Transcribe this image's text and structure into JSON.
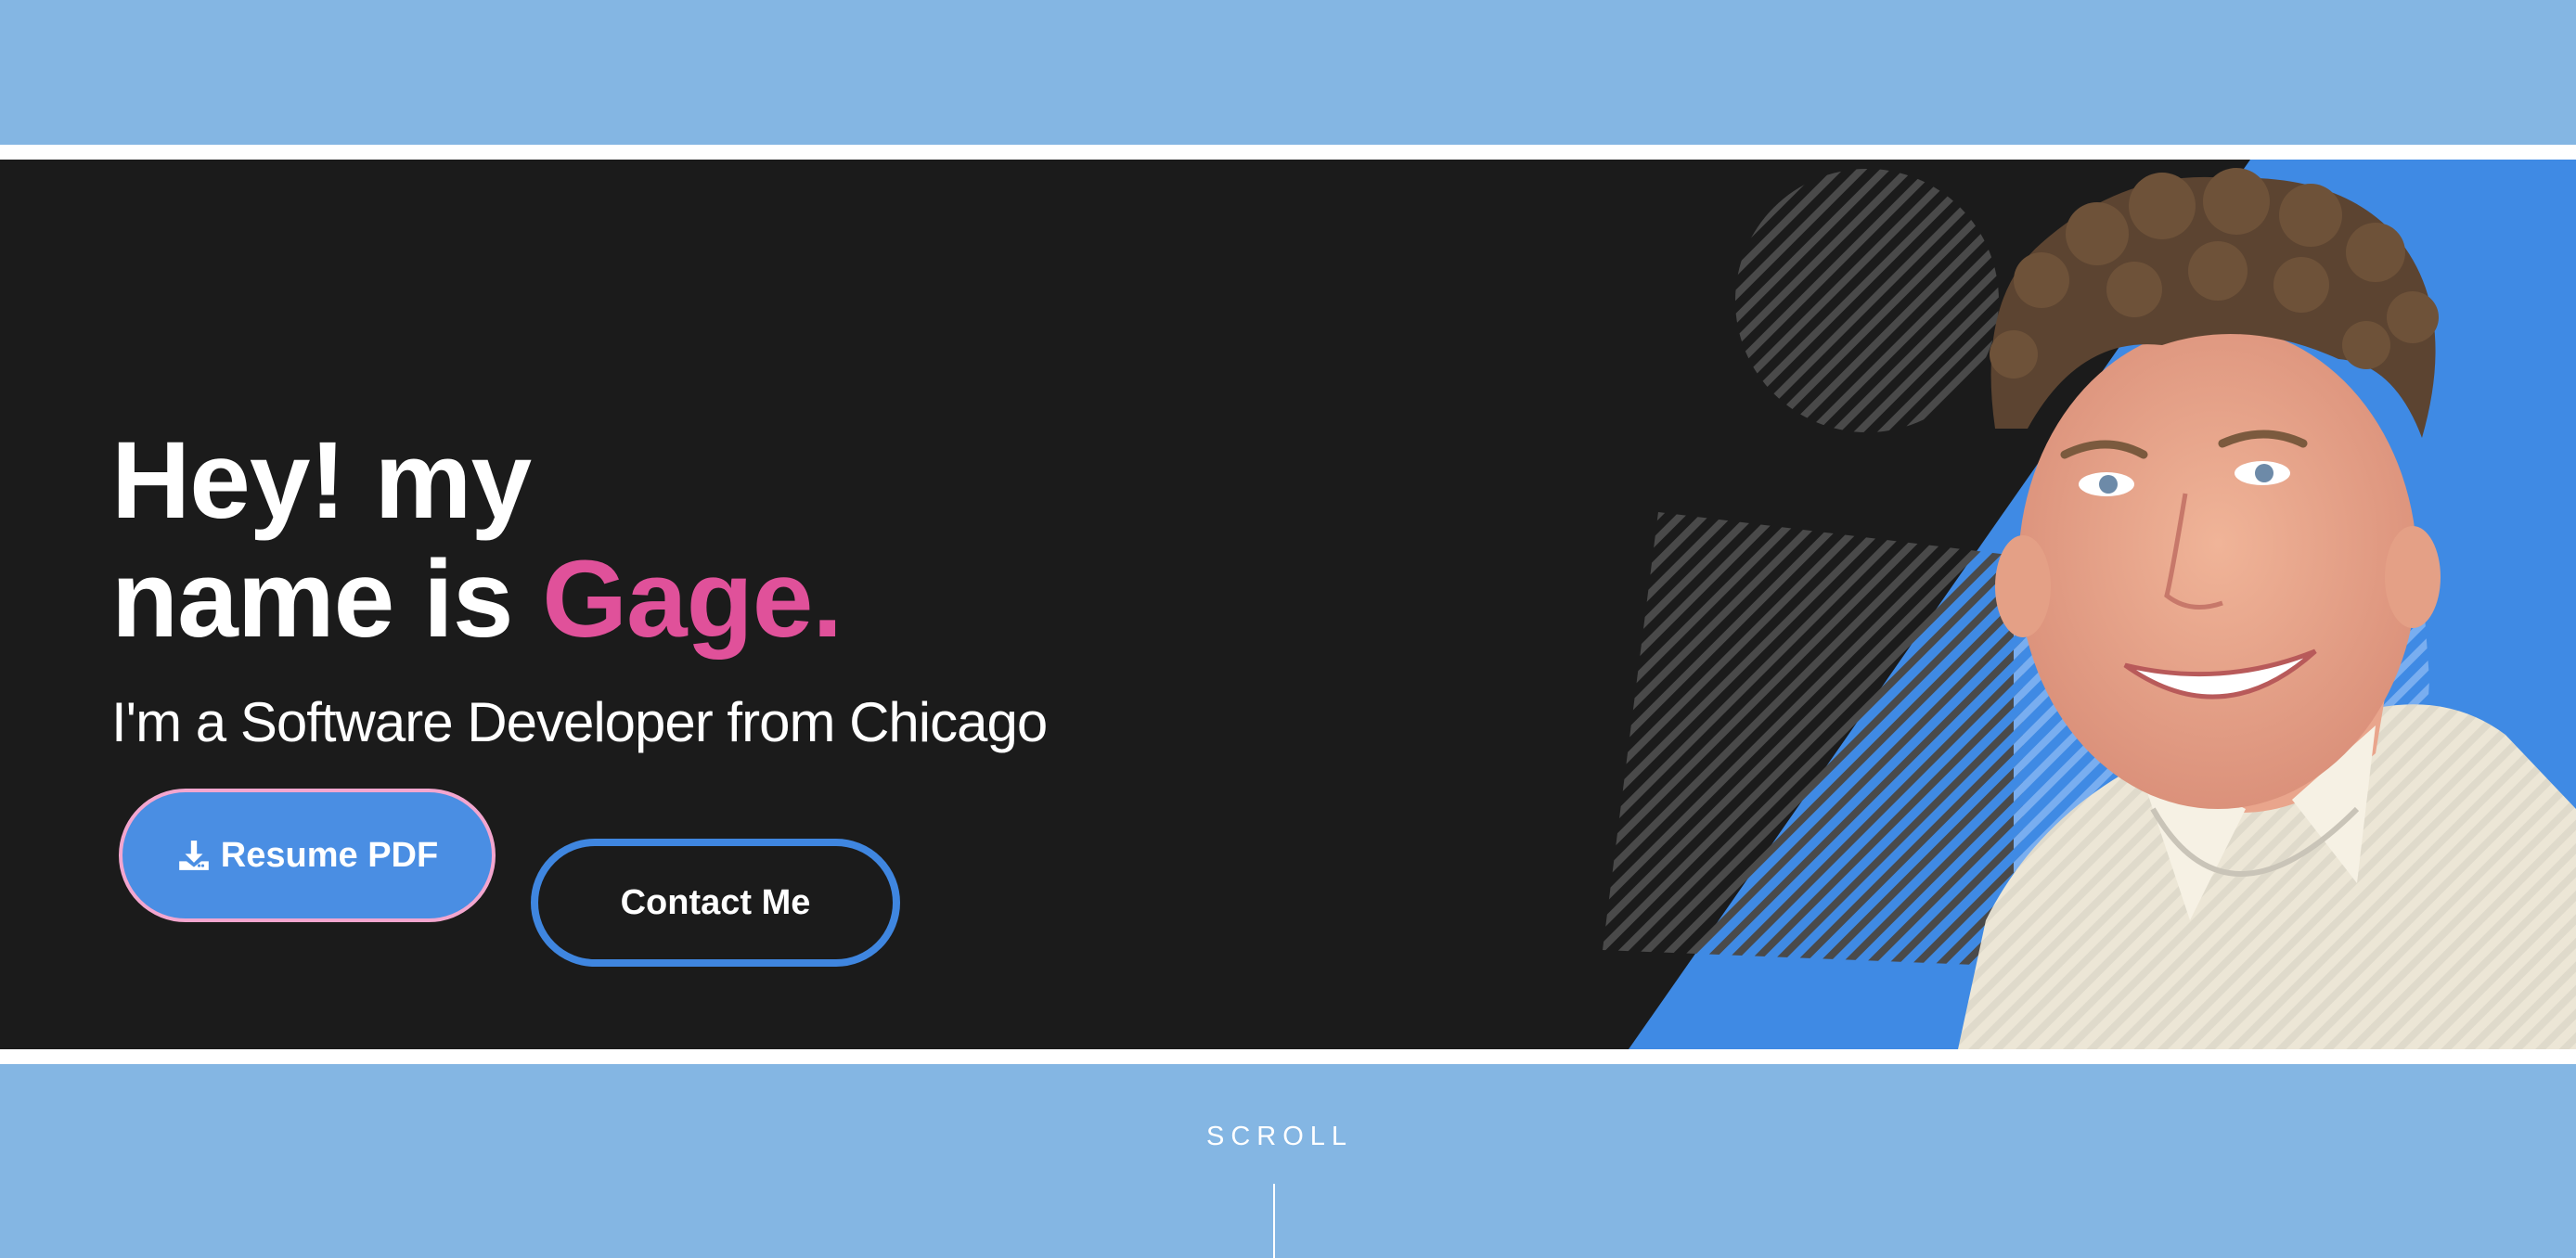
{
  "hero": {
    "greeting_line1": "Hey! my",
    "greeting_line2": "name is",
    "name": "Gage.",
    "subtitle": "I'm a Software Developer from Chicago",
    "resume_button_label": "Resume PDF",
    "resume_button_icon": "download-icon",
    "contact_button_label": "Contact Me"
  },
  "scroll": {
    "label": "SCROLL"
  },
  "colors": {
    "page_band": "#84b6e3",
    "hero_bg": "#1b1b1b",
    "accent_pink": "#e0519a",
    "accent_blue": "#4a8ee3"
  }
}
